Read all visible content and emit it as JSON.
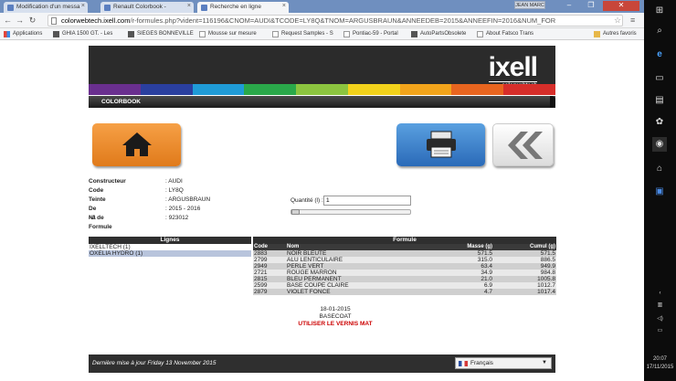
{
  "browser": {
    "tabs": [
      {
        "title": "Modification d'un messa"
      },
      {
        "title": "Renault Colorbook -"
      },
      {
        "title": "Recherche en ligne"
      }
    ],
    "user": "JEAN MARC",
    "url_host": "colorwebtech.ixell.com",
    "url_path": "/r-formules.php?vident=116196&CNOM=AUDI&TCODE=LY8Q&TNOM=ARGUSBRAUN&ANNEEDEB=2015&ANNEEFIN=2016&NUM_FOR"
  },
  "bookmarks": [
    {
      "label": "Applications",
      "icon": "apps"
    },
    {
      "label": "GHIA 1500 GT. - Les",
      "icon": "img"
    },
    {
      "label": "SIEGES BONNEVILLE",
      "icon": "img"
    },
    {
      "label": "Mousse sur mesure",
      "icon": "page"
    },
    {
      "label": "Request Samples - S",
      "icon": "page"
    },
    {
      "label": "Pontiac-59 - Portal",
      "icon": "page"
    },
    {
      "label": "AutoPartsObsolete",
      "icon": "img"
    },
    {
      "label": "About Fatsco Trans",
      "icon": "page"
    },
    {
      "label": "Autres favoris",
      "icon": "folder"
    }
  ],
  "header": {
    "logo": "ixell",
    "logo_sub": "colorwebtech",
    "section": "COLORBOOK",
    "stripe_colors": [
      "#6a2f8f",
      "#2a3f9f",
      "#1f9bd7",
      "#2aa84a",
      "#8cc43f",
      "#f2d21b",
      "#f2a41b",
      "#e8651f",
      "#d62e2a"
    ]
  },
  "info": [
    {
      "label": "Constructeur",
      "value": ": AUDI"
    },
    {
      "label": "Code",
      "value": ": LY8Q"
    },
    {
      "label": "Teinte",
      "value": ": ARGUSBRAUN"
    },
    {
      "label": "De - à",
      "value": ": 2015 - 2016"
    },
    {
      "label": "N° de Formule",
      "value": ": 923012"
    }
  ],
  "quantity": {
    "label": "Quantité (l) :",
    "value": "1"
  },
  "lignes": {
    "title": "Lignes",
    "items": [
      "IXELLTECH (1)",
      "OXELIA HYDRO (1)"
    ]
  },
  "formule": {
    "title": "Formule",
    "headers": {
      "code": "Code",
      "nom": "Nom",
      "masse": "Masse (g)",
      "cumul": "Cumul (g)"
    },
    "rows": [
      {
        "code": "2883",
        "nom": "NOIR BLEUTE",
        "masse": "571.5",
        "cumul": "571.5"
      },
      {
        "code": "2799",
        "nom": "ALU LENTICULAIRE",
        "masse": "315.0",
        "cumul": "886.5"
      },
      {
        "code": "2949",
        "nom": "PERLE VERT",
        "masse": "63.4",
        "cumul": "949.9"
      },
      {
        "code": "2721",
        "nom": "ROUGE MARRON",
        "masse": "34.9",
        "cumul": "984.8"
      },
      {
        "code": "2815",
        "nom": "BLEU PERMANENT",
        "masse": "21.0",
        "cumul": "1005.8"
      },
      {
        "code": "2599",
        "nom": "BASE COUPE CLAIRE",
        "masse": "6.9",
        "cumul": "1012.7"
      },
      {
        "code": "2879",
        "nom": "VIOLET FONCE",
        "masse": "4.7",
        "cumul": "1017.4"
      }
    ]
  },
  "details": {
    "date": "18-01-2015",
    "type": "BASECOAT",
    "note": "UTILISER LE VERNIS MAT"
  },
  "footer": {
    "updated": "Dernière mise à jour Friday 13 November 2015",
    "language": "Français"
  },
  "taskbar": {
    "time": "20:07",
    "date": "17/11/2015"
  }
}
